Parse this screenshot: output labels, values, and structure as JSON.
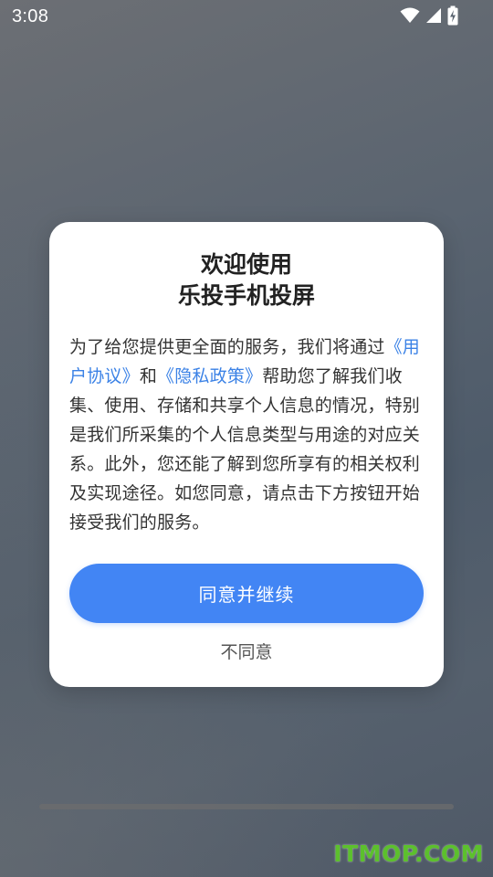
{
  "status_bar": {
    "time": "3:08",
    "icons": [
      "wifi-icon",
      "cellular-signal-icon",
      "battery-charging-icon"
    ]
  },
  "dialog": {
    "title_line1": "欢迎使用",
    "title_line2": "乐投手机投屏",
    "body": {
      "text_before_links": "为了给您提供更全面的服务，我们将通过",
      "user_agreement_link": "《用户协议》",
      "conjunction": "和",
      "privacy_policy_link": "《隐私政策》",
      "text_after_links": "帮助您了解我们收集、使用、存储和共享个人信息的情况，特别是我们所采集的个人信息类型与用途的对应关系。此外，您还能了解到您所享有的相关权利及实现途径。如您同意，请点击下方按钮开始接受我们的服务。"
    },
    "agree_button_label": "同意并继续",
    "disagree_button_label": "不同意"
  },
  "watermark": {
    "text": "ITMOP.COM"
  },
  "colors": {
    "accent": "#4285f4",
    "link": "#3b82e6",
    "watermark": "#5cc02d"
  }
}
